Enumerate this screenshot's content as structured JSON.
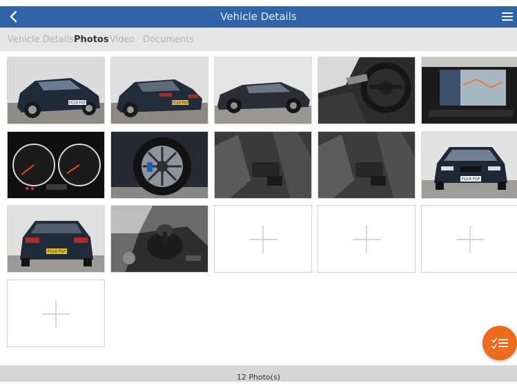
{
  "header": {
    "title": "Vehicle Details",
    "back_icon": "chevron-left-icon",
    "menu_icon": "hamburger-menu-icon",
    "background_color": "#2f65a8"
  },
  "tabs": [
    {
      "label": "Vehicle Details",
      "active": false
    },
    {
      "label": "Photos",
      "active": true
    },
    {
      "label": "Video",
      "active": false
    },
    {
      "label": "Documents",
      "active": false
    }
  ],
  "photos": [
    {
      "subject": "car-front-three-quarter",
      "plate": "FG18 FGF"
    },
    {
      "subject": "car-rear-three-quarter",
      "plate": "FG18 FGF"
    },
    {
      "subject": "car-side"
    },
    {
      "subject": "steering-wheel-dashboard"
    },
    {
      "subject": "infotainment-map-screen"
    },
    {
      "subject": "instrument-cluster"
    },
    {
      "subject": "alloy-wheel"
    },
    {
      "subject": "front-seats"
    },
    {
      "subject": "front-seats"
    },
    {
      "subject": "car-front",
      "plate": "FG18 FGF"
    },
    {
      "subject": "car-rear",
      "plate": "FG18 FGF"
    },
    {
      "subject": "gear-shifter"
    }
  ],
  "add_slots": 4,
  "add_icon": "plus-icon",
  "fab": {
    "icon": "checklist-icon",
    "color": "#ec6a1c"
  },
  "footer": {
    "photo_count": "12 Photo(s)"
  }
}
